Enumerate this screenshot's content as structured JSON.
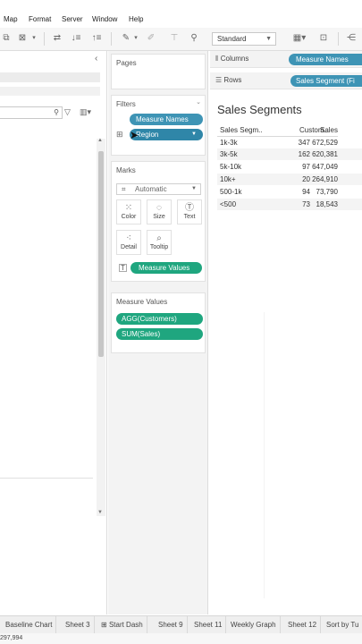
{
  "menu": [
    "Map",
    "Format",
    "Server",
    "Window",
    "Help"
  ],
  "toolbar": {
    "fit_select": "Standard"
  },
  "cards": {
    "pages_title": "Pages",
    "filters_title": "Filters",
    "filters_pills": [
      "Measure Names",
      "Region"
    ],
    "marks_title": "Marks",
    "marks_type": "Automatic",
    "marks_buttons": [
      "Color",
      "Size",
      "Text",
      "Detail",
      "Tooltip"
    ],
    "marks_text_pill": "Measure Values",
    "measure_values_title": "Measure Values",
    "measure_values_pills": [
      "AGG(Customers)",
      "SUM(Sales)"
    ]
  },
  "shelves": {
    "columns_label": "Columns",
    "columns_pill": "Measure Names",
    "rows_label": "Rows",
    "rows_pill": "Sales Segment (Fi"
  },
  "view": {
    "title": "Sales Segments",
    "headers": [
      "Sales Segm..",
      "Custom..",
      "Sales"
    ],
    "rows": [
      [
        "1k-3k",
        "347",
        "672,529"
      ],
      [
        "3k-5k",
        "162",
        "620,381"
      ],
      [
        "5k-10k",
        "97",
        "647,049"
      ],
      [
        "10k+",
        "20",
        "264,910"
      ],
      [
        "500-1k",
        "94",
        "73,790"
      ],
      [
        "<500",
        "73",
        "18,543"
      ]
    ]
  },
  "tabs": [
    "Baseline Chart",
    "Sheet 3",
    "Start Dash",
    "Sheet 9",
    "Sheet 11",
    "Weekly Graph",
    "Sheet 12",
    "Sort by Tu"
  ],
  "status": "297,994"
}
